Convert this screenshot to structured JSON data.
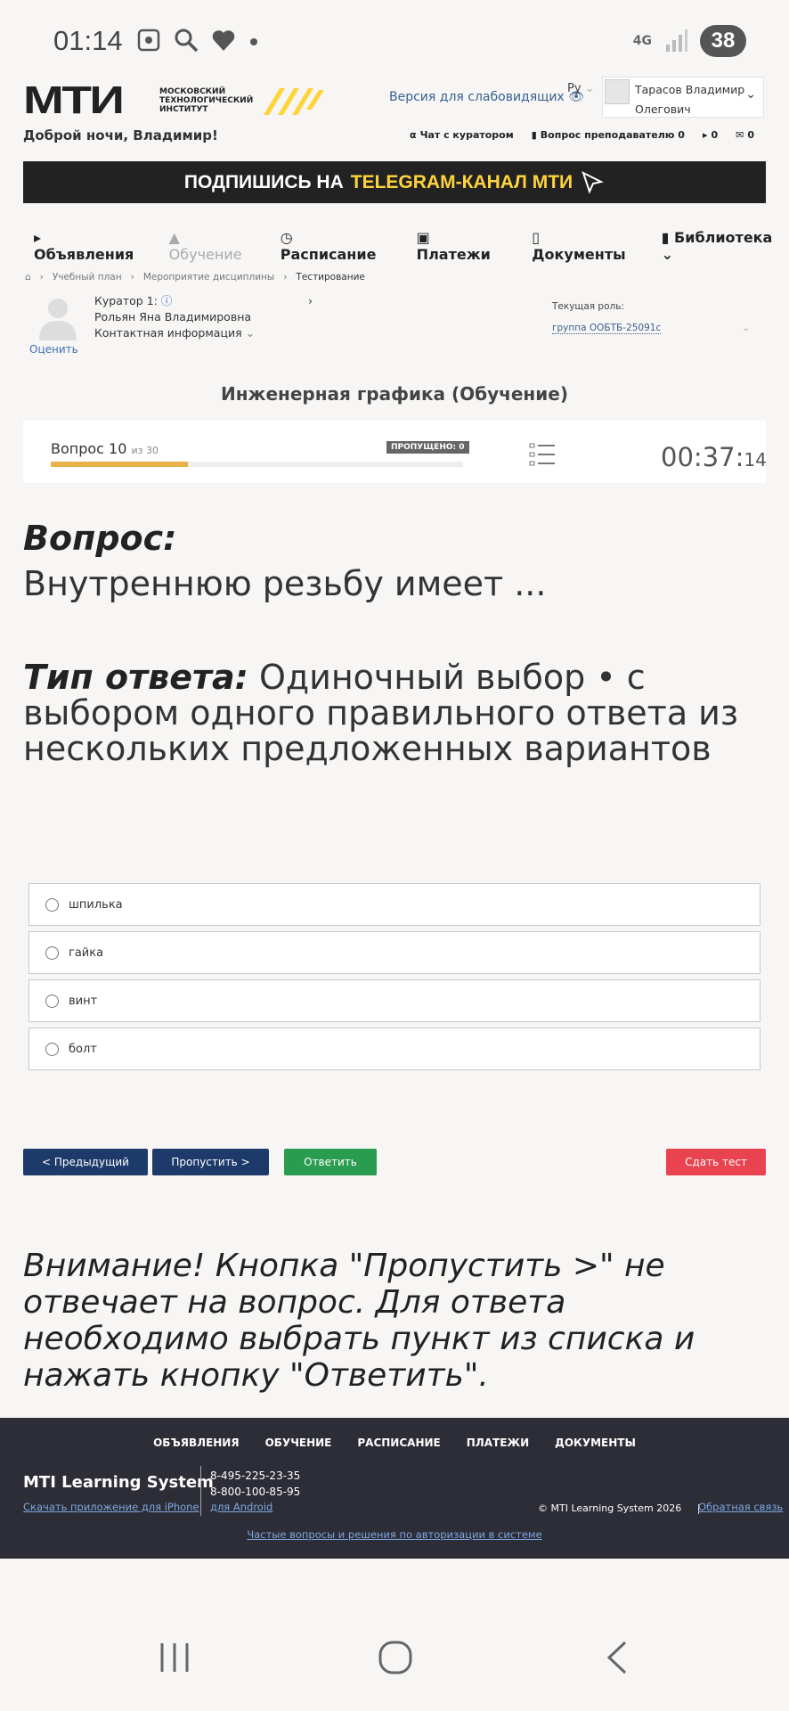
{
  "status": {
    "time": "01:14",
    "network": "4G",
    "battery": "38"
  },
  "header": {
    "logo_mark": "МТИ",
    "logo_sub": [
      "МОСКОВСКИЙ",
      "ТЕХНОЛОГИЧЕСКИЙ",
      "ИНСТИТУТ"
    ],
    "vision_link": "Версия для слабовидящих",
    "lang": "Ру",
    "user_name_line1": "Тарасов Владимир",
    "user_name_line2": "Олегович",
    "greeting": "Доброй ночи, Владимир!",
    "links": [
      {
        "icon": "headset-icon",
        "label": "Чат с куратором"
      },
      {
        "icon": "book-icon",
        "label": "Вопрос преподавателю 0"
      },
      {
        "icon": "megaphone-icon",
        "label": "0"
      },
      {
        "icon": "mail-icon",
        "label": "0"
      }
    ]
  },
  "banner": {
    "prefix": "ПОДПИШИСЬ НА",
    "highlight": "TELEGRAM-КАНАЛ МТИ"
  },
  "nav": [
    {
      "label": "Объявления",
      "disabled": false
    },
    {
      "label": "Обучение",
      "disabled": true
    },
    {
      "label": "Расписание",
      "disabled": false
    },
    {
      "label": "Платежи",
      "disabled": false
    },
    {
      "label": "Документы",
      "disabled": false
    },
    {
      "label": "Библиотека",
      "disabled": false
    }
  ],
  "breadcrumb": [
    "Учебный план",
    "Мероприятие дисциплины",
    "Тестирование"
  ],
  "curator": {
    "title": "Куратор 1:",
    "name": "Рольян Яна Владимировна",
    "contacts": "Контактная информация",
    "rate": "Оценить"
  },
  "role": {
    "label": "Текущая роль:",
    "group": "группа ООБТБ-25091с"
  },
  "course_title": "Инженерная графика (Обучение)",
  "quiz": {
    "question_label": "Вопрос 10",
    "of_label": "из 30",
    "skipped_badge": "ПРОПУЩЕНО: 0",
    "progress": 0.333,
    "timer_main": "00:37:",
    "timer_sec": "14"
  },
  "question": {
    "label": "Вопрос:",
    "text": "Внутреннюю резьбу имеет ...",
    "type_label": "Тип ответа:",
    "type_text": " Одиночный выбор • с выбором одного правильного ответа из нескольких предложенных вариантов"
  },
  "answers": [
    "шпилька",
    "гайка",
    "винт",
    "болт"
  ],
  "buttons": {
    "prev": "< Предыдущий",
    "skip": "Пропустить >",
    "answer": "Ответить",
    "finish": "Сдать тест"
  },
  "warning": "Внимание! Кнопка \"Пропустить >\" не отвечает на вопрос. Для ответа необходимо выбрать пункт из списка и нажать кнопку \"Ответить\".",
  "footer": {
    "nav": [
      "ОБЪЯВЛЕНИЯ",
      "ОБУЧЕНИЕ",
      "РАСПИСАНИЕ",
      "ПЛАТЕЖИ",
      "ДОКУМЕНТЫ"
    ],
    "brand": "MTI Learning System",
    "phone1": "8-495-225-23-35",
    "phone2": "8-800-100-85-95",
    "app_iphone": "Скачать приложение для iPhone",
    "app_android": "для Android",
    "copyright": "© MTI Learning System 2026",
    "separator": "|",
    "feedback": "Обратная связь",
    "faq": "Частые вопросы и решения по авторизации в системе"
  },
  "colors": {
    "accent_yellow": "#ffd43b",
    "navy": "#1e3a6b",
    "green": "#2a9c4f",
    "red": "#e9434f",
    "footer_bg": "#2c2d36"
  }
}
